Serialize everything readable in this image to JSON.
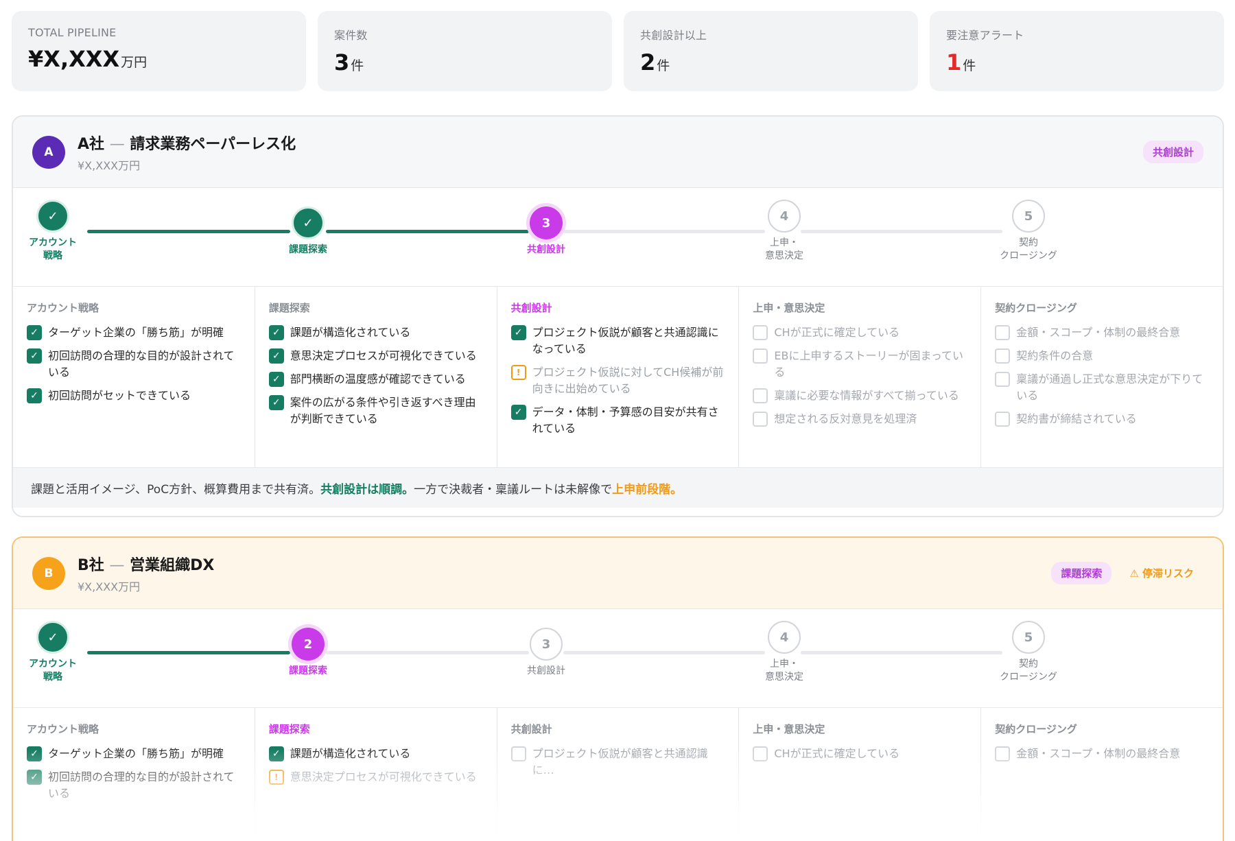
{
  "kpis": [
    {
      "label": "TOTAL PIPELINE",
      "value": "¥X,XXX",
      "unit": "万円"
    },
    {
      "label": "案件数",
      "value": "3",
      "unit": "件"
    },
    {
      "label": "共創設計以上",
      "value": "2",
      "unit": "件"
    },
    {
      "label": "要注意アラート",
      "value": "1",
      "unit": "件"
    }
  ],
  "steps": [
    "アカウント戦略",
    "課題探索",
    "共創設計",
    "上申・意思決定",
    "契約クロージング"
  ],
  "deal_a": {
    "avatar": "A",
    "company": "A社",
    "dash": "—",
    "project": "請求業務ペーパーレス化",
    "amount": "¥X,XXX万円",
    "badge": "共創設計",
    "stepper": {
      "n1_label_l1": "アカウント",
      "n1_label_l2": "戦略",
      "n2_label": "課題探索",
      "n3_num": "3",
      "n3_label": "共創設計",
      "n4_num": "4",
      "n4_label_l1": "上申・",
      "n4_label_l2": "意思決定",
      "n5_num": "5",
      "n5_label_l1": "契約",
      "n5_label_l2": "クロージング",
      "check": "✓"
    },
    "columns": [
      {
        "title": "アカウント戦略",
        "items": [
          {
            "text": "ターゲット企業の「勝ち筋」が明確",
            "state": "checked"
          },
          {
            "text": "初回訪問の合理的な目的が設計されている",
            "state": "checked"
          },
          {
            "text": "初回訪問がセットできている",
            "state": "checked"
          }
        ]
      },
      {
        "title": "課題探索",
        "items": [
          {
            "text": "課題が構造化されている",
            "state": "checked"
          },
          {
            "text": "意思決定プロセスが可視化できている",
            "state": "checked"
          },
          {
            "text": "部門横断の温度感が確認できている",
            "state": "checked"
          },
          {
            "text": "案件の広がる条件や引き返すべき理由が判断できている",
            "state": "checked"
          }
        ]
      },
      {
        "title": "共創設計",
        "items": [
          {
            "text": "プロジェクト仮説が顧客と共通認識になっている",
            "state": "checked"
          },
          {
            "text": "プロジェクト仮説に対してCH候補が前向きに出始めている",
            "state": "warn"
          },
          {
            "text": "データ・体制・予算感の目安が共有されている",
            "state": "checked"
          }
        ]
      },
      {
        "title": "上申・意思決定",
        "items": [
          {
            "text": "CHが正式に確定している",
            "state": "empty"
          },
          {
            "text": "EBに上申するストーリーが固まっている",
            "state": "empty"
          },
          {
            "text": "稟議に必要な情報がすべて揃っている",
            "state": "empty"
          },
          {
            "text": "想定される反対意見を処理済",
            "state": "empty"
          }
        ]
      },
      {
        "title": "契約クロージング",
        "items": [
          {
            "text": "金額・スコープ・体制の最終合意",
            "state": "empty"
          },
          {
            "text": "契約条件の合意",
            "state": "empty"
          },
          {
            "text": "稟議が通過し正式な意思決定が下りている",
            "state": "empty"
          },
          {
            "text": "契約書が締結されている",
            "state": "empty"
          }
        ]
      }
    ],
    "summary": {
      "part1": "課題と活用イメージ、PoC方針、概算費用まで共有済。",
      "ok": "共創設計は順調。",
      "part2": "一方で決裁者・稟議ルートは未解像で",
      "warn": "上申前段階。"
    }
  },
  "deal_b": {
    "avatar": "B",
    "company": "B社",
    "dash": "—",
    "project": "営業組織DX",
    "amount": "¥X,XXX万円",
    "badge": "課題探索",
    "risk": "⚠ 停滞リスク",
    "stepper": {
      "n1_label_l1": "アカウント",
      "n1_label_l2": "戦略",
      "n2_num": "2",
      "n2_label": "課題探索",
      "n3_num": "3",
      "n3_label": "共創設計",
      "n4_num": "4",
      "n4_label_l1": "上申・",
      "n4_label_l2": "意思決定",
      "n5_num": "5",
      "n5_label_l1": "契約",
      "n5_label_l2": "クロージング",
      "check": "✓"
    },
    "columns": [
      {
        "title": "アカウント戦略",
        "items": [
          {
            "text": "ターゲット企業の「勝ち筋」が明確",
            "state": "checked"
          },
          {
            "text": "初回訪問の合理的な目的が設計されている",
            "state": "checked"
          }
        ]
      },
      {
        "title": "課題探索",
        "items": [
          {
            "text": "課題が構造化されている",
            "state": "checked"
          },
          {
            "text": "意思決定プロセスが可視化できている",
            "state": "warn"
          }
        ]
      },
      {
        "title": "共創設計",
        "items": [
          {
            "text": "プロジェクト仮説が顧客と共通認識に…",
            "state": "empty"
          }
        ]
      },
      {
        "title": "上申・意思決定",
        "items": [
          {
            "text": "CHが正式に確定している",
            "state": "empty"
          }
        ]
      },
      {
        "title": "契約クロージング",
        "items": [
          {
            "text": "金額・スコープ・体制の最終合意",
            "state": "empty"
          }
        ]
      }
    ]
  },
  "colors": {
    "accent_green": "#177d62",
    "accent_purple": "#c93ae8",
    "warn_orange": "#f29a12",
    "alert_red": "#e32b2b"
  }
}
